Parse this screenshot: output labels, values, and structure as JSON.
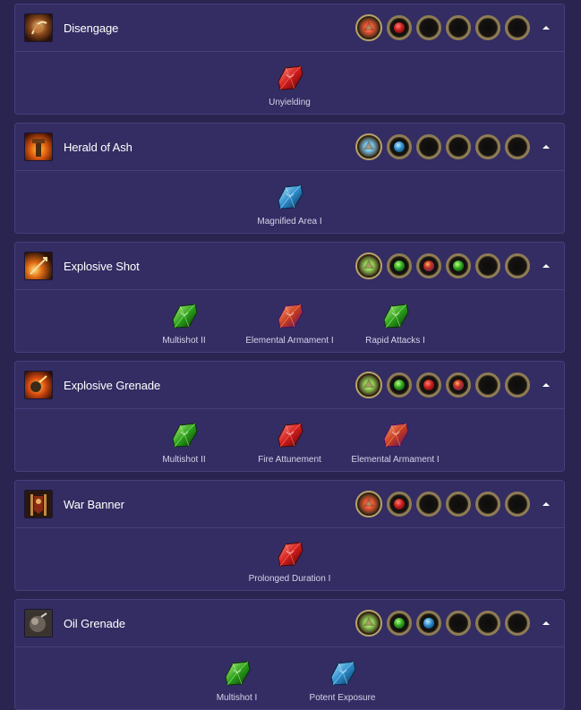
{
  "skills": [
    {
      "name": "Disengage",
      "icon": "disengage-skill-icon",
      "sockets": [
        "red",
        "empty",
        "empty",
        "empty",
        "empty"
      ],
      "supports": [
        {
          "label": "Unyielding",
          "color": "red"
        }
      ]
    },
    {
      "name": "Herald of Ash",
      "icon": "herald-of-ash-skill-icon",
      "sockets": [
        "blue",
        "empty",
        "empty",
        "empty",
        "empty"
      ],
      "supports": [
        {
          "label": "Magnified Area I",
          "color": "blue"
        }
      ]
    },
    {
      "name": "Explosive Shot",
      "icon": "explosive-shot-skill-icon",
      "sockets": [
        "green",
        "purple",
        "green",
        "empty",
        "empty"
      ],
      "supports": [
        {
          "label": "Multishot II",
          "color": "green"
        },
        {
          "label": "Elemental Armament I",
          "color": "purple"
        },
        {
          "label": "Rapid Attacks I",
          "color": "green"
        }
      ]
    },
    {
      "name": "Explosive Grenade",
      "icon": "explosive-grenade-skill-icon",
      "sockets": [
        "green",
        "red",
        "purple",
        "empty",
        "empty"
      ],
      "supports": [
        {
          "label": "Multishot II",
          "color": "green"
        },
        {
          "label": "Fire Attunement",
          "color": "red"
        },
        {
          "label": "Elemental Armament I",
          "color": "purple"
        }
      ]
    },
    {
      "name": "War Banner",
      "icon": "war-banner-skill-icon",
      "sockets": [
        "red",
        "empty",
        "empty",
        "empty",
        "empty"
      ],
      "supports": [
        {
          "label": "Prolonged Duration I",
          "color": "red"
        }
      ]
    },
    {
      "name": "Oil Grenade",
      "icon": "oil-grenade-skill-icon",
      "sockets": [
        "green",
        "blue",
        "empty",
        "empty",
        "empty"
      ],
      "supports": [
        {
          "label": "Multishot I",
          "color": "green"
        },
        {
          "label": "Potent Exposure",
          "color": "blue"
        }
      ]
    }
  ],
  "colors": {
    "background": "#2a2550",
    "card": "#332d63",
    "border": "#463f7c",
    "red": "#c51c1c",
    "green": "#2da21f",
    "blue": "#2d8ac9",
    "purple": "#8a2a6d"
  }
}
